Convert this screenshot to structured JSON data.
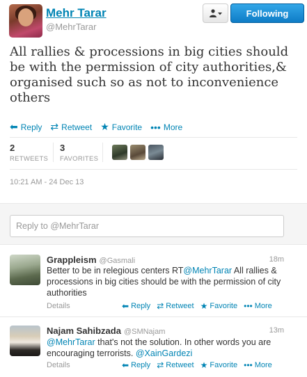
{
  "tweet": {
    "fullname": "Mehr Tarar",
    "screenname": "@MehrTarar",
    "text": "All rallies & processions in big cities should be with the permission of city authorities,& organised such so as not to inconvenience others",
    "retweets": "2",
    "retweets_label": "RETWEETS",
    "favorites": "3",
    "favorites_label": "FAVORITES",
    "timestamp": "10:21 AM - 24 Dec 13"
  },
  "header": {
    "following_label": "Following",
    "dropdown_icon": "user-dropdown-icon"
  },
  "actions": {
    "reply": "Reply",
    "retweet": "Retweet",
    "favorite": "Favorite",
    "more": "More"
  },
  "reply_box": {
    "placeholder": "Reply to @MehrTarar"
  },
  "replies": [
    {
      "name": "Grappleism",
      "handle": "@Gasmali",
      "time": "18m",
      "text_parts": [
        "Better to be in relegious centers RT",
        "@MehrTarar",
        " All rallies & processions in big cities should be with the permission of city authorities"
      ],
      "details": "Details"
    },
    {
      "name": "Najam Sahibzada",
      "handle": "@SMNajam",
      "time": "13m",
      "text_parts": [
        "@MehrTarar",
        " that's not the solution. In other words you are encouraging terrorists. ",
        "@XainGardezi"
      ],
      "details": "Details"
    }
  ],
  "colors": {
    "link": "#0084b4",
    "follow_button": "#1b8fd6"
  }
}
